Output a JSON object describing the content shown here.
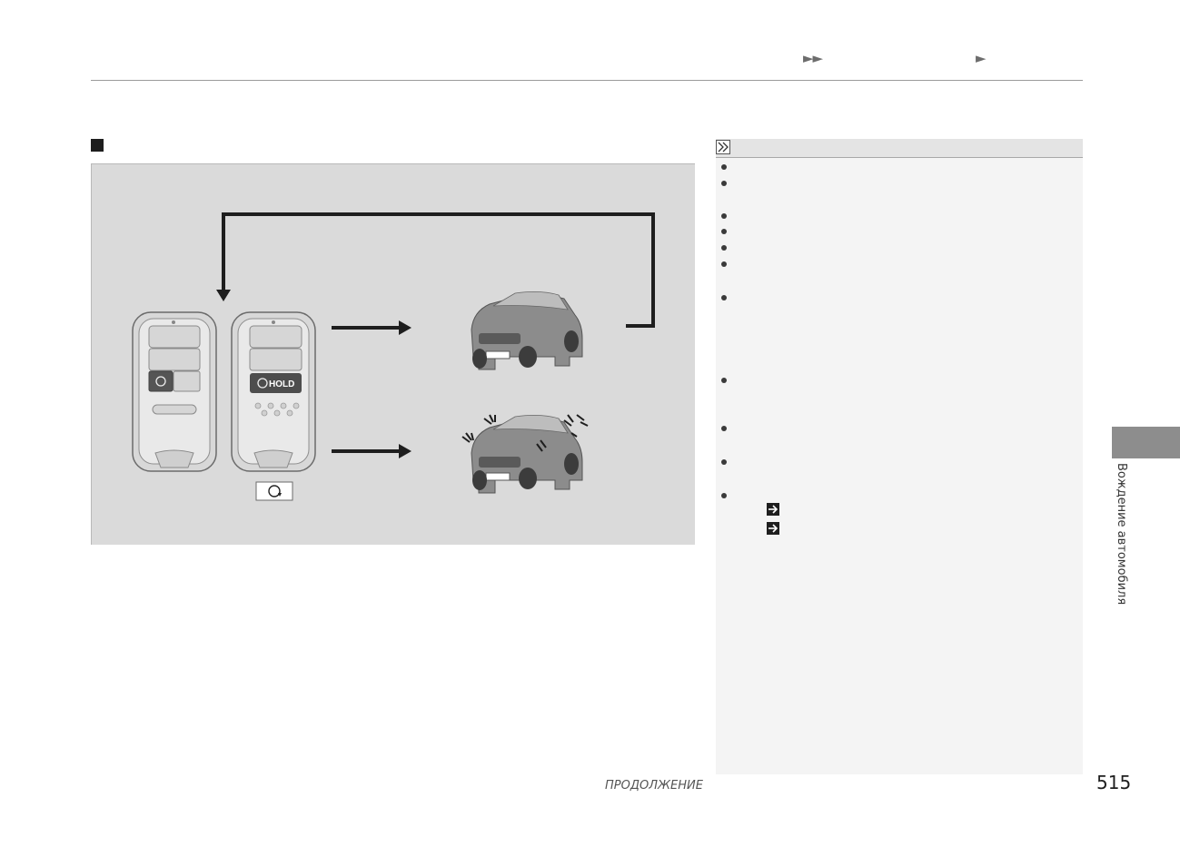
{
  "header": {
    "arrows_primary": "►►",
    "arrows_secondary": "►"
  },
  "illustration": {
    "remote_button_label": "HOLD"
  },
  "notes": {
    "bullet_count": 13,
    "reference_arrow_count": 2
  },
  "side_tab": {
    "label": "Вождение автомобиля"
  },
  "footer": {
    "continue_label": "ПРОДОЛЖЕНИЕ",
    "page_number": "515"
  }
}
